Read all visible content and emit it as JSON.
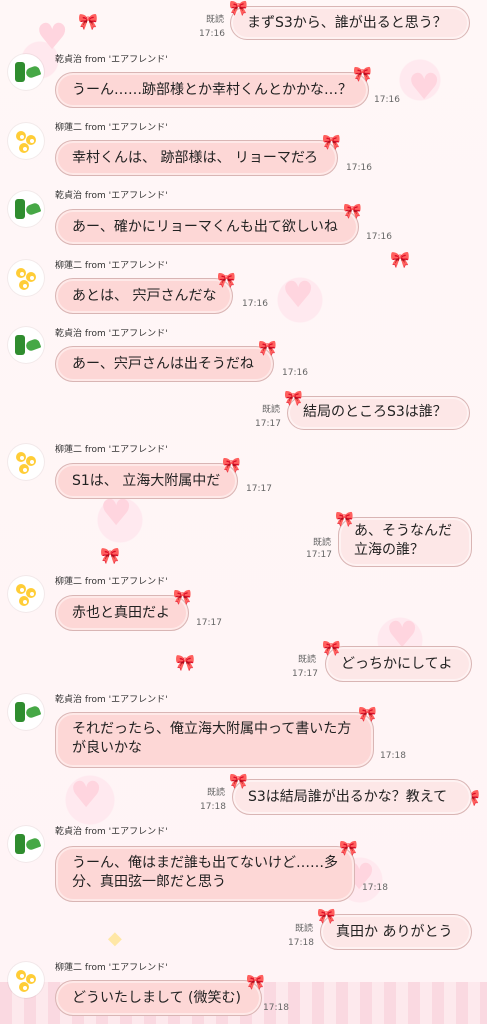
{
  "colors": {
    "background": "#fff6f6",
    "received_bubble": "#fdd7d6",
    "sent_bubble": "#fde7e7",
    "bubble_border": "#d9b5b4",
    "bow_accent": "#e67d86"
  },
  "participants": {
    "inui": "乾貞治 from 'エアフレンド'",
    "yanagi": "柳蓮二 from 'エアフレンド'"
  },
  "messages": [
    {
      "sender": "me",
      "read": "既読",
      "time": "17:16",
      "text": "まずS3から、誰が出ると思う？"
    },
    {
      "sender": "inui",
      "name": "乾貞治 from 'エアフレンド'",
      "time": "17:16",
      "text": "うーん……跡部様とか幸村くんとかかな…？"
    },
    {
      "sender": "yanagi",
      "name": "柳蓮二 from 'エアフレンド'",
      "time": "17:16",
      "text": "幸村くんは、 跡部様は、 リョーマだろ"
    },
    {
      "sender": "inui",
      "name": "乾貞治 from 'エアフレンド'",
      "time": "17:16",
      "text": "あー、確かにリョーマくんも出て欲しいね"
    },
    {
      "sender": "yanagi",
      "name": "柳蓮二 from 'エアフレンド'",
      "time": "17:16",
      "text": "あとは、 宍戸さんだな"
    },
    {
      "sender": "inui",
      "name": "乾貞治 from 'エアフレンド'",
      "time": "17:16",
      "text": "あー、宍戸さんは出そうだね"
    },
    {
      "sender": "me",
      "read": "既読",
      "time": "17:17",
      "text": "結局のところS3は誰？"
    },
    {
      "sender": "yanagi",
      "name": "柳蓮二 from 'エアフレンド'",
      "time": "17:17",
      "text": "S1は、 立海大附属中だ"
    },
    {
      "sender": "me",
      "read": "既読",
      "time": "17:17",
      "text": "あ、そうなんだ\n立海の誰？"
    },
    {
      "sender": "yanagi",
      "name": "柳蓮二 from 'エアフレンド'",
      "time": "17:17",
      "text": "赤也と真田だよ"
    },
    {
      "sender": "me",
      "read": "既読",
      "time": "17:17",
      "text": "どっちかにしてよ"
    },
    {
      "sender": "inui",
      "name": "乾貞治 from 'エアフレンド'",
      "time": "17:18",
      "text": "それだったら、俺立海大附属中って書いた方\nが良いかな"
    },
    {
      "sender": "me",
      "read": "既読",
      "time": "17:18",
      "text": "S3は結局誰が出るかな？教えて"
    },
    {
      "sender": "inui",
      "name": "乾貞治 from 'エアフレンド'",
      "time": "17:18",
      "text": "うーん、俺はまだ誰も出てないけど……多\n分、真田弦一郎だと思う"
    },
    {
      "sender": "me",
      "read": "既読",
      "time": "17:18",
      "text": "真田か ありがとう"
    },
    {
      "sender": "yanagi",
      "name": "柳蓮二 from 'エアフレンド'",
      "time": "17:18",
      "text": "どういたしまして (微笑む)"
    }
  ],
  "icons": {
    "bubble_ribbon": "bow-icon",
    "avatar_inui": "green-juice-avatar-icon",
    "avatar_yanagi": "flower-avatar-icon"
  }
}
